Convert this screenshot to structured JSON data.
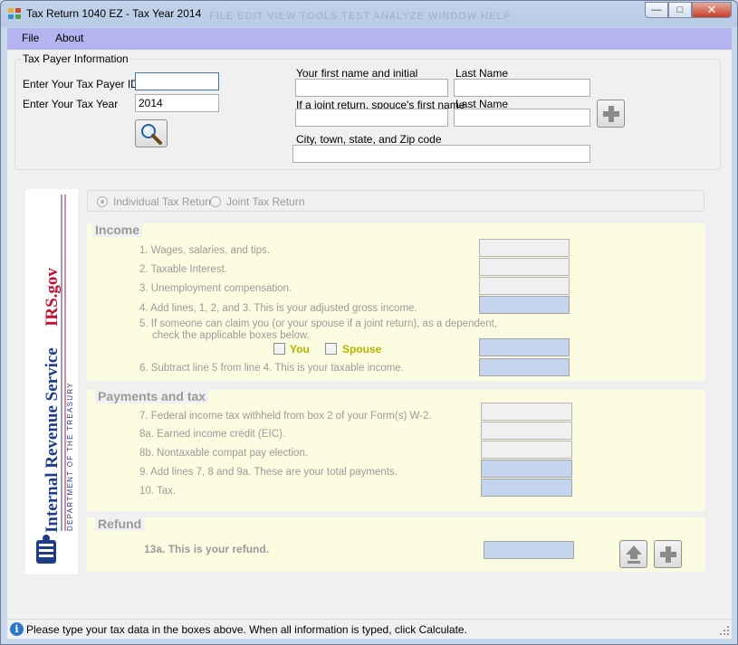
{
  "window": {
    "title": "Tax Return 1040 EZ - Tax Year 2014",
    "ghost_menu": "FILE    EDIT    VIEW    TOOLS    TEST    ANALYZE    WINDOW    HELP"
  },
  "menu": {
    "file": "File",
    "about": "About"
  },
  "taxpayer": {
    "group_title": "Tax Payer Information",
    "id_label": "Enter Your Tax Payer ID",
    "id_value": "",
    "year_label": "Enter Your Tax Year",
    "year_value": "2014",
    "first_name_label": "Your first name and initial",
    "last_name_label": "Last Name",
    "spouse_first_label": "If a joint return, spouce's first name",
    "spouse_last_label": "Last Name",
    "address_label": "City, town, state, and Zip code"
  },
  "return_type": {
    "individual": "Individual Tax Return",
    "joint": "Joint Tax Return",
    "selected": "individual"
  },
  "income": {
    "title": "Income",
    "line1": "1. Wages, salaries, and tips.",
    "line2": "2. Taxable Interest.",
    "line3": "3. Unemployment compensation.",
    "line4": "4. Add lines, 1, 2, and 3. This is your adjusted gross income.",
    "line5a": "5. If someone can claim you (or your spouse if a joint return), as a dependent,",
    "line5b": "check the applicable boxes below.",
    "you": "You",
    "spouse": "Spouse",
    "line6": "6. Subtract line 5 from line 4. This is your taxable income."
  },
  "payments": {
    "title": "Payments and tax",
    "line7": "7. Federal income tax withheld from box 2 of your Form(s) W-2.",
    "line8a": "8a. Earned income credit (EIC).",
    "line8b": "8b. Nontaxable compat pay election.",
    "line9": "9. Add lines 7, 8 and 9a. These are your total payments.",
    "line10": "10. Tax."
  },
  "refund": {
    "title": "Refund",
    "line13a": "13a. This is your refund."
  },
  "logo": {
    "name": "Internal Revenue Service",
    "site": "IRS.gov",
    "dept": "DEPARTMENT OF THE TREASURY"
  },
  "status": {
    "text": "Please type your tax data in the boxes above. When all information is typed, click Calculate."
  },
  "colors": {
    "menubar": "#b4b4f0",
    "panel": "#fcfce0",
    "calc_field": "#c4d4ec",
    "irs_blue": "#1f3c8b",
    "irs_red": "#c8102e",
    "checkbox_label": "#b3b300"
  }
}
